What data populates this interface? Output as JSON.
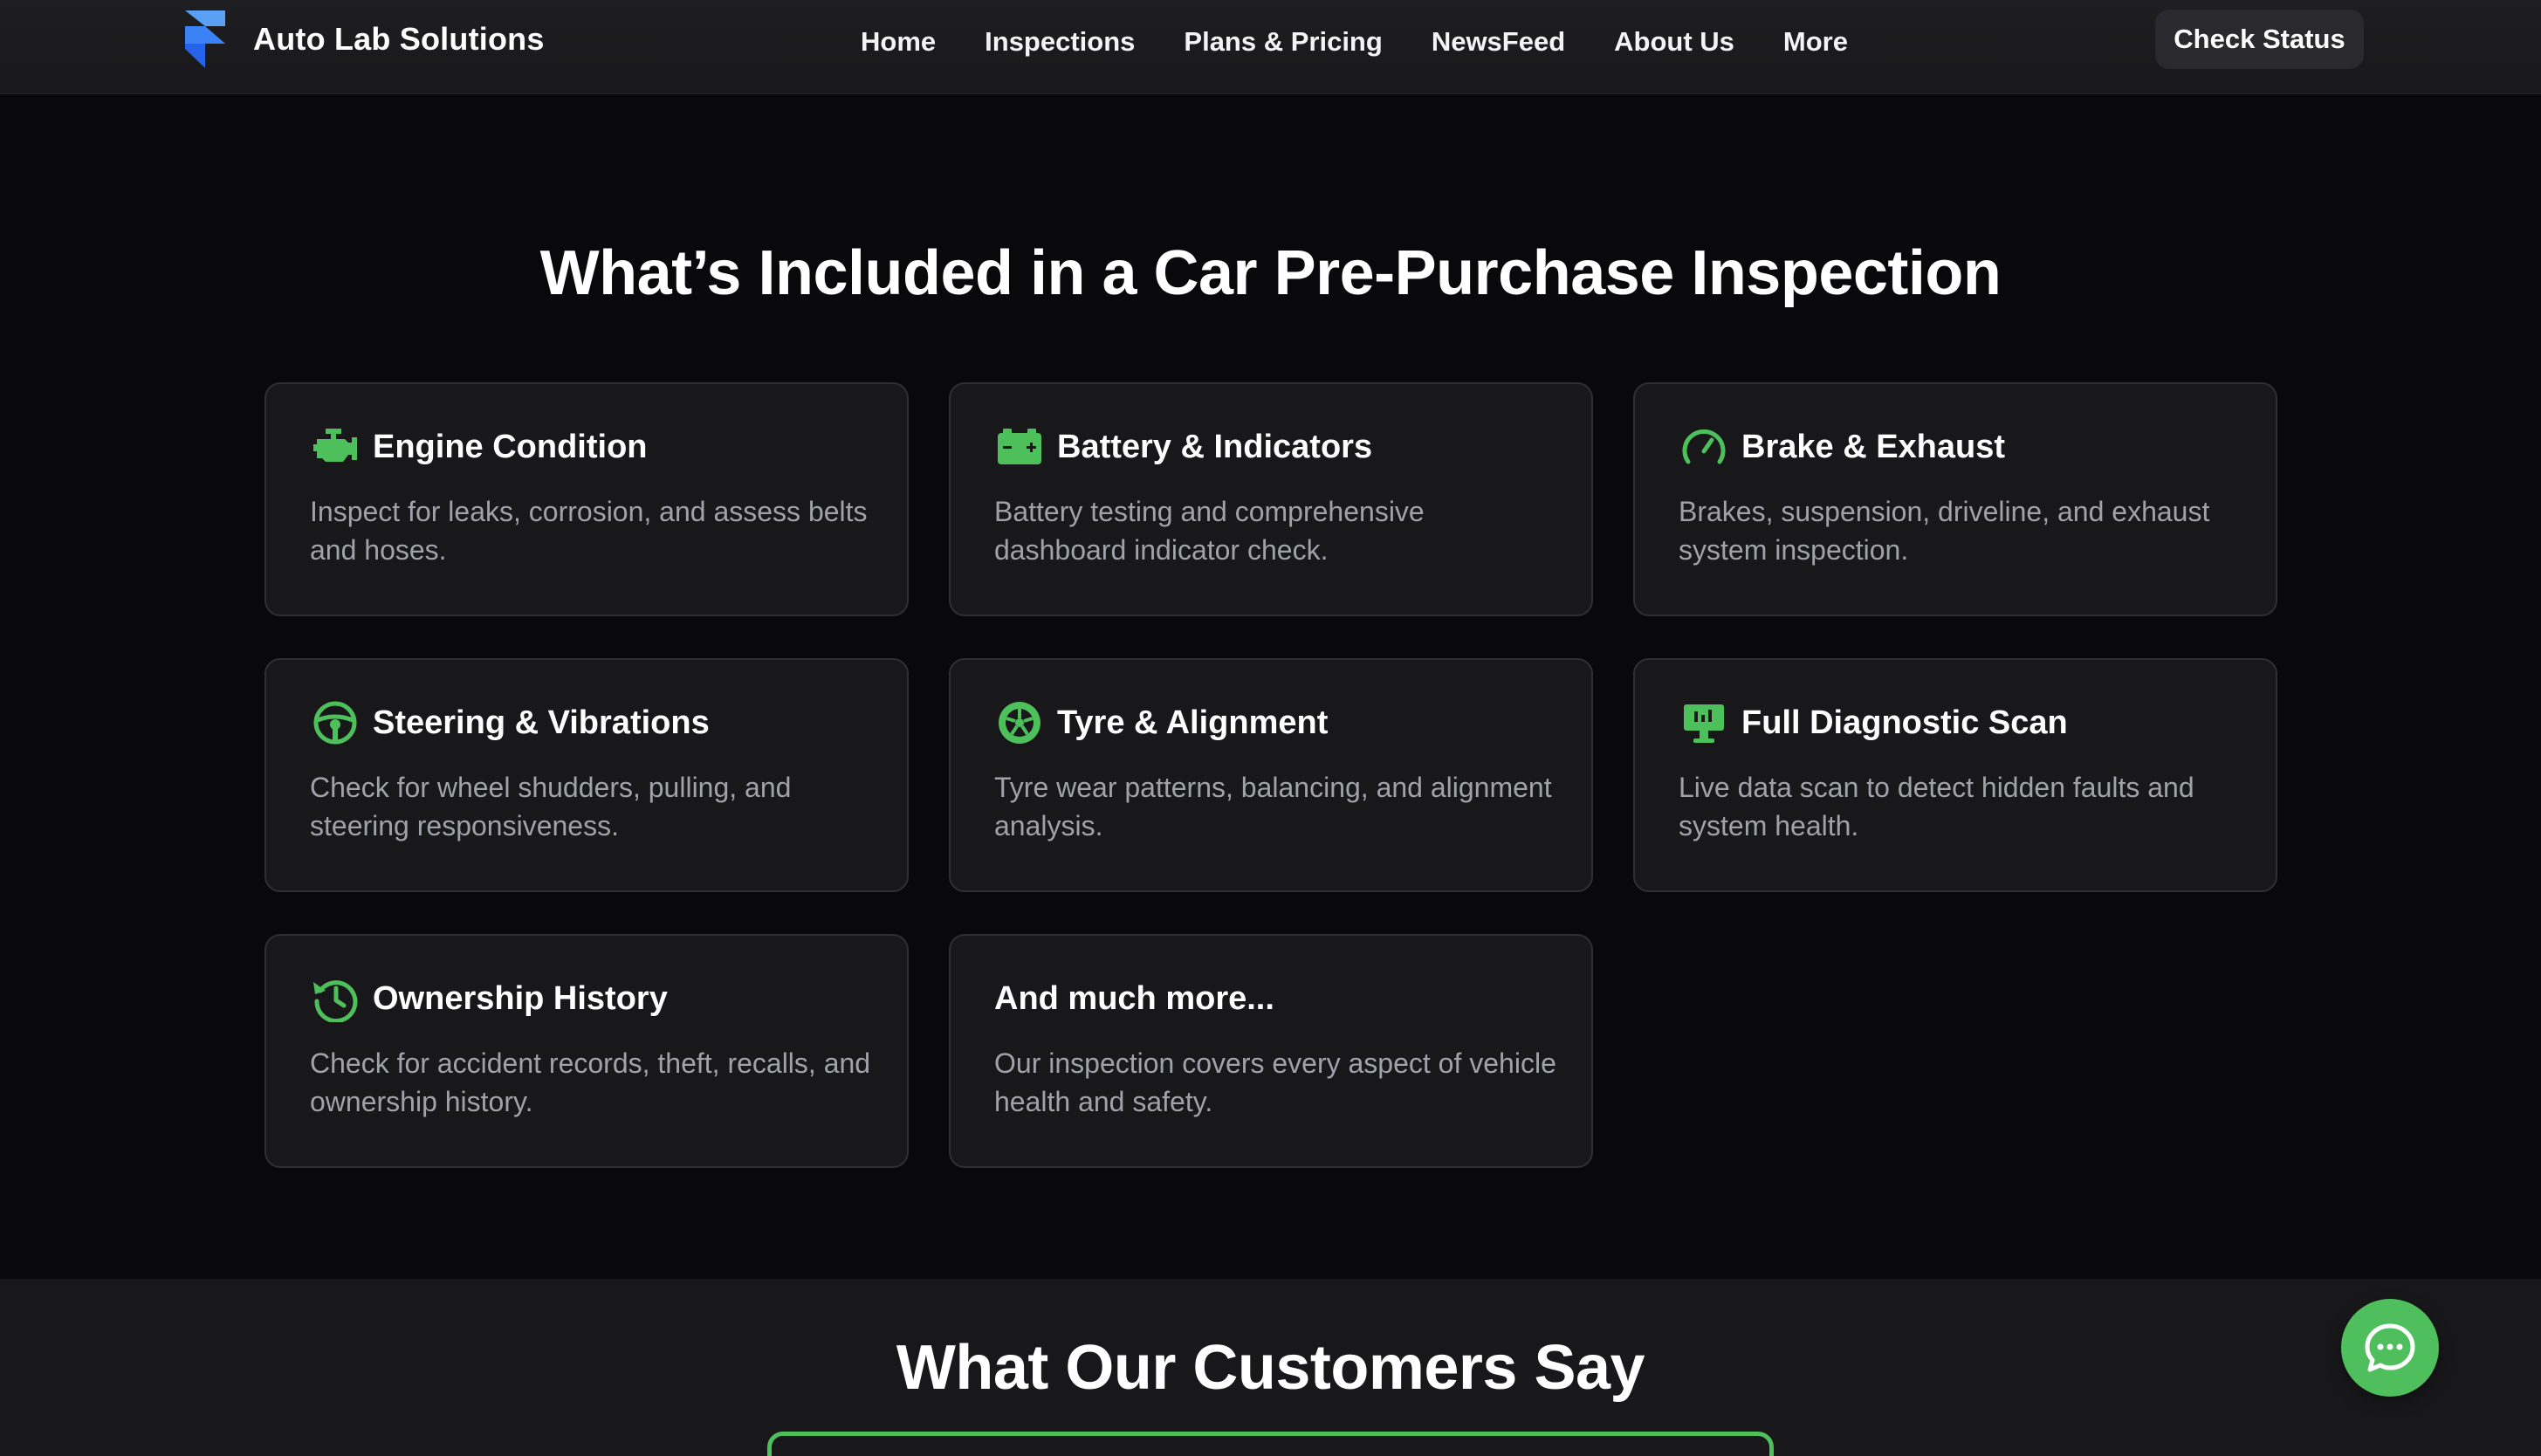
{
  "colors": {
    "background": "#09090b",
    "navbar": "#1c1c1f",
    "card": "#18181b",
    "accent": "#4ec05b",
    "muted_text": "#a1a1aa"
  },
  "header": {
    "brand_name": "Auto Lab Solutions",
    "logo_icon": "framer-logo-icon",
    "nav": [
      "Home",
      "Inspections",
      "Plans & Pricing",
      "NewsFeed",
      "About Us",
      "More"
    ],
    "cta_label": "Check Status"
  },
  "included": {
    "title": "What’s Included in a Car Pre-Purchase Inspection",
    "cards": [
      {
        "icon": "engine-icon",
        "title": "Engine Condition",
        "desc": "Inspect for leaks, corrosion, and assess belts and hoses."
      },
      {
        "icon": "battery-icon",
        "title": "Battery & Indicators",
        "desc": "Battery testing and comprehensive dashboard indicator check."
      },
      {
        "icon": "gauge-icon",
        "title": "Brake & Exhaust",
        "desc": "Brakes, suspension, driveline, and exhaust system inspection."
      },
      {
        "icon": "steering-wheel-icon",
        "title": "Steering & Vibrations",
        "desc": "Check for wheel shudders, pulling, and steering responsiveness."
      },
      {
        "icon": "tyre-icon",
        "title": "Tyre & Alignment",
        "desc": "Tyre wear patterns, balancing, and alignment analysis."
      },
      {
        "icon": "diagnostic-monitor-icon",
        "title": "Full Diagnostic Scan",
        "desc": "Live data scan to detect hidden faults and system health."
      },
      {
        "icon": "history-icon",
        "title": "Ownership History",
        "desc": "Check for accident records, theft, recalls, and ownership history."
      },
      {
        "icon": "",
        "title": "And much more...",
        "desc": "Our inspection covers every aspect of vehicle health and safety."
      }
    ]
  },
  "customers": {
    "title": "What Our Customers Say"
  },
  "chat": {
    "icon": "chat-bubble-icon"
  }
}
